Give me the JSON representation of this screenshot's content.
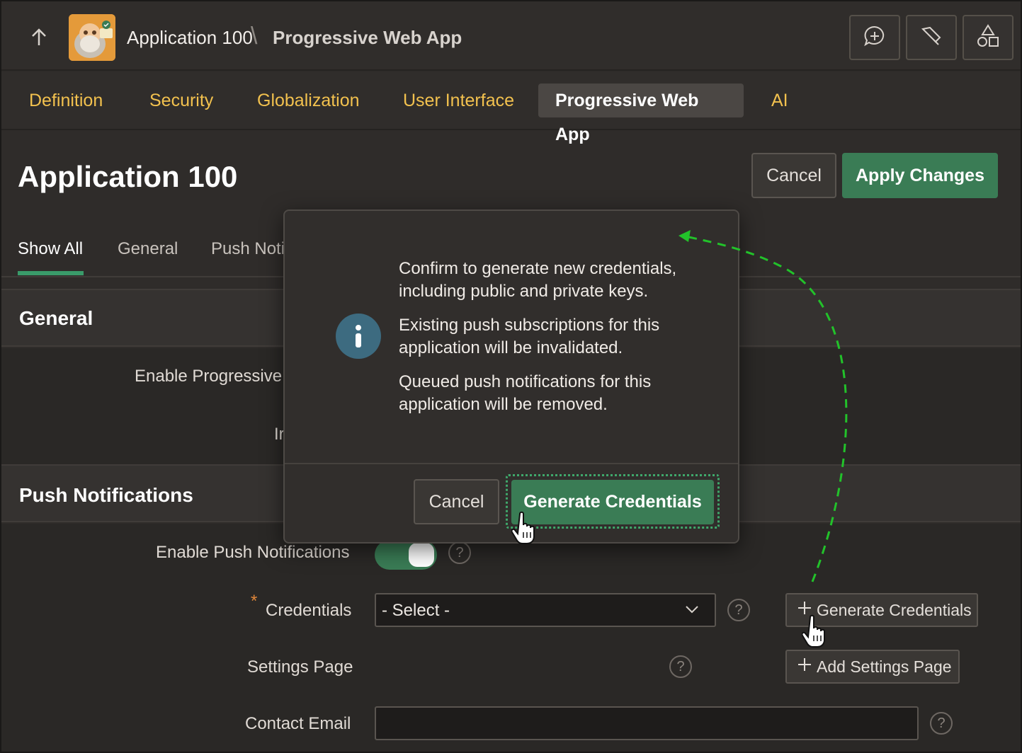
{
  "header": {
    "breadcrumb_app": "Application 100",
    "breadcrumb_separator": "\\",
    "breadcrumb_page": "Progressive Web App",
    "tools": [
      "feedback-icon",
      "developer-tools-icon",
      "shared-components-icon"
    ]
  },
  "tabs": [
    {
      "label": "Definition",
      "active": false
    },
    {
      "label": "Security",
      "active": false
    },
    {
      "label": "Globalization",
      "active": false
    },
    {
      "label": "User Interface",
      "active": false
    },
    {
      "label": "Progressive Web App",
      "active": true
    },
    {
      "label": "AI",
      "active": false
    }
  ],
  "page": {
    "title": "Application 100",
    "cancel_label": "Cancel",
    "apply_label": "Apply Changes"
  },
  "region_tabs": {
    "show_all": "Show All",
    "general": "General",
    "push": "Push Noti"
  },
  "general": {
    "title": "General",
    "enable_pwa_label": "Enable Progressive ",
    "install_label_fragment": "Ir"
  },
  "push": {
    "title": "Push Notifications",
    "enable_label": "Enable Push Notifications",
    "enable_value": true,
    "required_marker": "*",
    "credentials_label": "Credentials",
    "credentials_value": "- Select -",
    "generate_button": "Generate Credentials",
    "settings_label": "Settings Page",
    "settings_button": "Add Settings Page",
    "contact_label": "Contact Email",
    "contact_value": ""
  },
  "dialog": {
    "message_1": "Confirm to generate new credentials, including public and private keys.",
    "message_2": "Existing push subscriptions for this application will be invalidated.",
    "message_3": "Queued push notifications for this application will be removed.",
    "cancel_label": "Cancel",
    "confirm_label": "Generate Credentials"
  },
  "colors": {
    "accent_green": "#3a7c55",
    "tab_yellow": "#f2c14e",
    "info_blue": "#3d6b80",
    "annotation_arrow": "#22c22a"
  }
}
